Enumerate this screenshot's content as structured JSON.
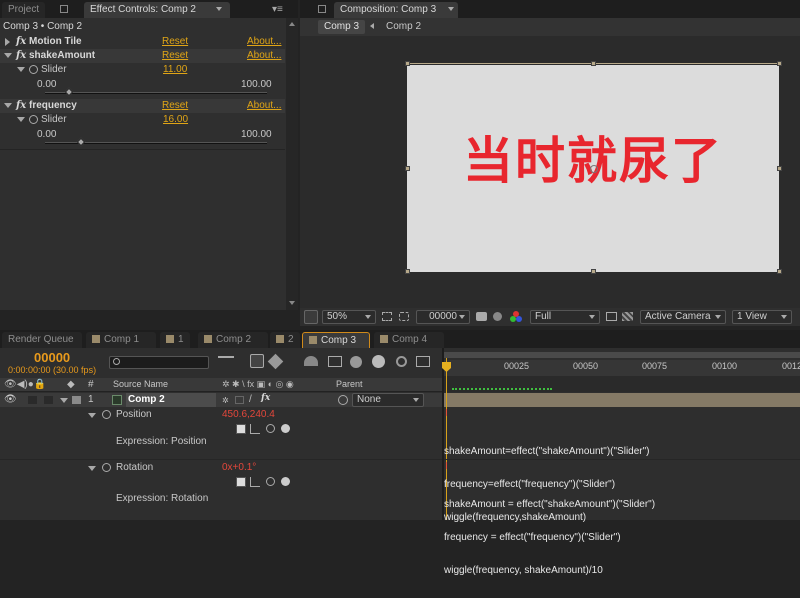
{
  "effect_panel": {
    "tabs": [
      {
        "label": "Project"
      },
      {
        "label": "Effect Controls: Comp 2"
      }
    ],
    "breadcrumb": "Comp 3 • Comp 2",
    "effects": [
      {
        "name": "Motion Tile",
        "reset": "Reset",
        "about": "About..."
      },
      {
        "name": "shakeAmount",
        "reset": "Reset",
        "about": "About...",
        "slider_label": "Slider",
        "value": "11.00",
        "min": "0.00",
        "max": "100.00",
        "fraction": 0.11
      },
      {
        "name": "frequency",
        "reset": "Reset",
        "about": "About...",
        "slider_label": "Slider",
        "value": "16.00",
        "min": "0.00",
        "max": "100.00",
        "fraction": 0.16
      }
    ]
  },
  "comp_panel": {
    "tab": "Composition: Comp 3",
    "flow_current": "Comp 3",
    "flow_child": "Comp 2",
    "canvas_text": "当时就尿了",
    "zoom": "50%",
    "timecode": "00000",
    "resolution": "Full",
    "camera": "Active Camera",
    "views": "1 View"
  },
  "timeline": {
    "tabs": [
      {
        "label": "Render Queue"
      },
      {
        "label": "Comp 1"
      },
      {
        "label": "1"
      },
      {
        "label": "Comp 2"
      },
      {
        "label": "2"
      },
      {
        "label": "Comp 3"
      },
      {
        "label": "Comp 4"
      }
    ],
    "frame": "00000",
    "timecode_fps": "0:00:00:00 (30.00 fps)",
    "search_placeholder": "",
    "col_num": "#",
    "col_source": "Source Name",
    "col_parent": "Parent",
    "layer": {
      "index": "1",
      "name": "Comp 2",
      "parent": "None"
    },
    "position": {
      "label": "Position",
      "value": "450.6,240.4",
      "expr_label": "Expression: Position"
    },
    "rotation": {
      "label": "Rotation",
      "value": "0x+0.1°",
      "expr_label": "Expression: Rotation"
    },
    "expr_position": [
      "shakeAmount=effect(\"shakeAmount\")(\"Slider\")",
      "frequency=effect(\"frequency\")(\"Slider\")",
      "wiggle(frequency,shakeAmount)"
    ],
    "expr_rotation": [
      "shakeAmount = effect(\"shakeAmount\")(\"Slider\")",
      "frequency = effect(\"frequency\")(\"Slider\")",
      "wiggle(frequency, shakeAmount)/10"
    ],
    "ruler": [
      "00025",
      "00050",
      "00075",
      "00100",
      "0012"
    ]
  }
}
